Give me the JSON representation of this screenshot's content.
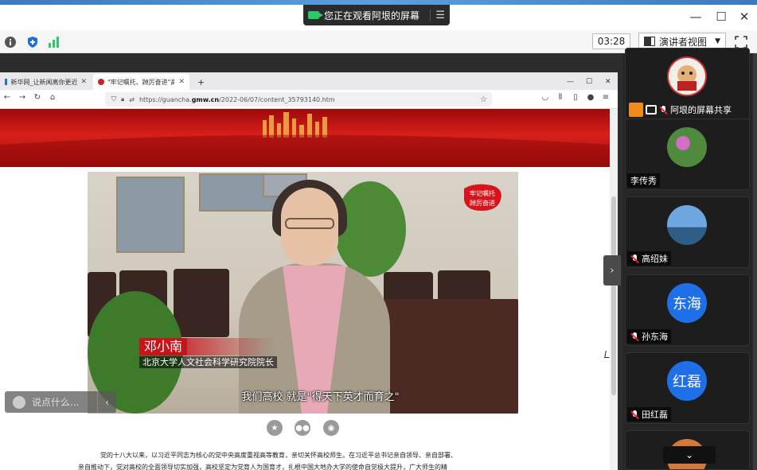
{
  "meeting": {
    "banner_text": "您正在观看阿垠的屏幕",
    "timer": "03:28",
    "view_button": "演讲者视图",
    "colors": {
      "accent_green": "#2cc96b",
      "shield_blue": "#1f6fd1",
      "avatar_blue": "#1e6fe8"
    }
  },
  "browser": {
    "tabs": [
      {
        "label": "新华网_让新闻离你更近",
        "active": false
      },
      {
        "label": "\"牢记嘱托、踔厉奋进\"高校访谈",
        "active": true
      }
    ],
    "url_prefix": "https://guancha.",
    "url_domain": "gmw.cn",
    "url_path": "/2022-06/07/content_35793140.htm"
  },
  "video": {
    "name_caption": "邓小南",
    "role_caption": "北京大学人文社会科学研究院院长",
    "subtitle": "我们高校  就是\"得天下英才而育之\"",
    "logo_text_line1": "牢记嘱托",
    "logo_text_line2": "踔厉奋进"
  },
  "article": {
    "line1": "党的十八大以来，以习近平同志为核心的党中央高度重视高等教育，亲切关怀高校师生。在习近平总书记亲自领导、亲自部署、",
    "line2": "亲自推动下，党对高校的全面领导切实加强，高校坚定为党育人为国育才，扎根中国大地办大学的使命自觉极大提升，广大师生的精"
  },
  "comment": {
    "placeholder": "说点什么..."
  },
  "participants": [
    {
      "name": "阿垠的屏幕共享",
      "avatar_text": "",
      "avatar_color": "#c33"
    },
    {
      "name": "李传秀",
      "avatar_text": "",
      "avatar_color": "#3d7a3a"
    },
    {
      "name": "高绍妹",
      "avatar_text": "",
      "avatar_color": "#4a7db0"
    },
    {
      "name": "孙东海",
      "avatar_text": "东海",
      "avatar_color": "#1e6fe8"
    },
    {
      "name": "田红磊",
      "avatar_text": "红磊",
      "avatar_color": "#1e6fe8"
    },
    {
      "name": "",
      "avatar_text": "",
      "avatar_color": "#d37a3a"
    }
  ]
}
